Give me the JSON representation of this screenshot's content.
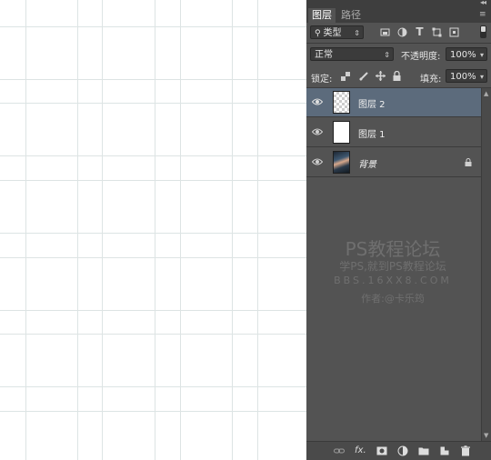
{
  "panel": {
    "tabs": [
      {
        "label": "图层",
        "active": true
      },
      {
        "label": "路径",
        "active": false
      }
    ],
    "filter": {
      "label": "类型"
    },
    "blend_mode": "正常",
    "opacity": {
      "label": "不透明度:",
      "value": "100%"
    },
    "lock": {
      "label": "锁定:"
    },
    "fill": {
      "label": "填充:",
      "value": "100%"
    },
    "layers": [
      {
        "name": "图层 2",
        "selected": true,
        "visible": true,
        "thumb": "transparent"
      },
      {
        "name": "图层 1",
        "selected": false,
        "visible": true,
        "thumb": "white"
      },
      {
        "name": "背景",
        "selected": false,
        "visible": true,
        "thumb": "photo",
        "locked": true
      }
    ],
    "watermark": {
      "line1": "PS教程论坛",
      "line2": "学PS,就到PS教程论坛",
      "line3": "BBS.16XX8.COM",
      "line4": "作者:@卡乐筠"
    },
    "bottom_icons": [
      "link-icon",
      "fx-icon",
      "mask-icon",
      "adjustment-icon",
      "folder-icon",
      "new-layer-icon",
      "trash-icon"
    ],
    "bottom_fx_label": "fx."
  },
  "colors": {
    "panel_bg": "#535353",
    "selected_layer": "#5c6b7c",
    "canvas_bg": "#ffffff"
  }
}
